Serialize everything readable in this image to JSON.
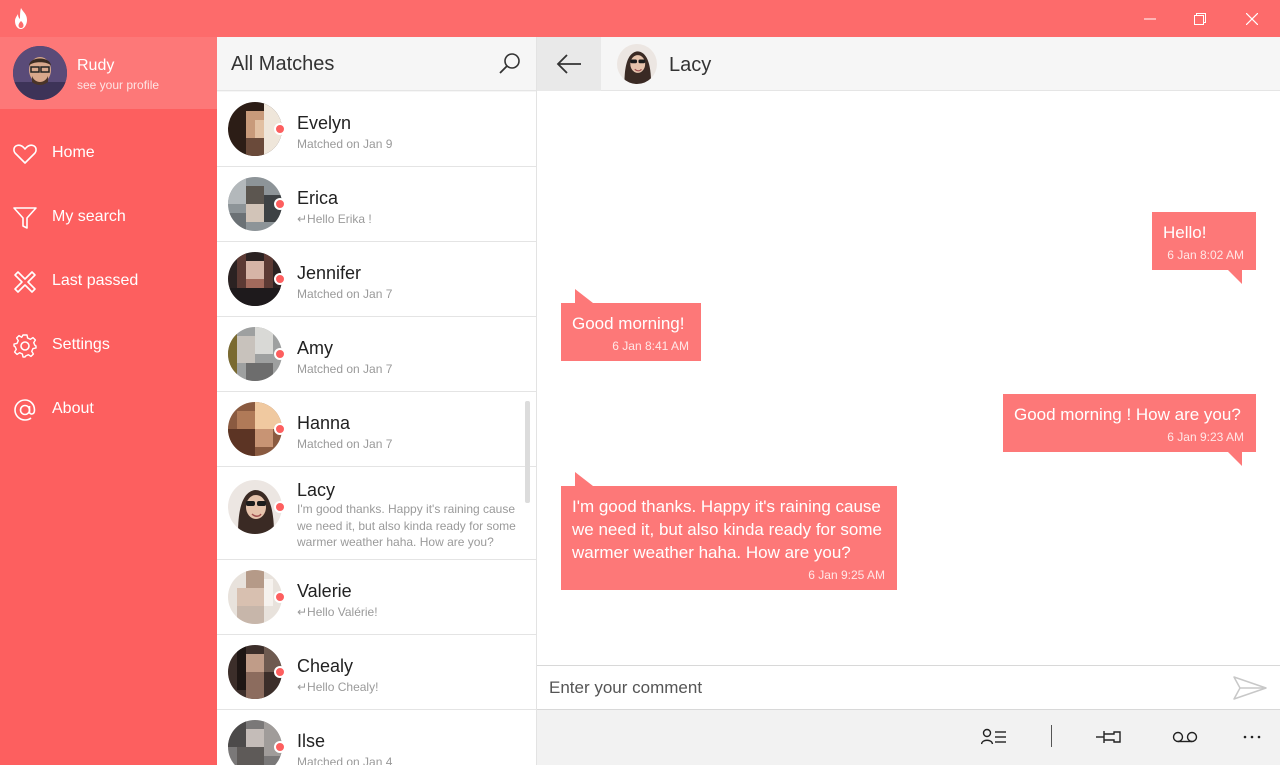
{
  "colors": {
    "accent": "#fd6b6b",
    "sidebar": "#fd5f5f",
    "bubble": "#fd7878",
    "online_dot": "#fd5f5f"
  },
  "titlebar": {
    "logo_icon": "flame-icon",
    "buttons": [
      "minimize-icon",
      "restore-icon",
      "close-icon"
    ]
  },
  "profile": {
    "name": "Rudy",
    "subtitle": "see your profile"
  },
  "nav": [
    {
      "label": "Home",
      "icon": "heart-icon"
    },
    {
      "label": "My search",
      "icon": "filter-icon"
    },
    {
      "label": "Last passed",
      "icon": "cross-icon"
    },
    {
      "label": "Settings",
      "icon": "gear-icon"
    },
    {
      "label": "About",
      "icon": "at-icon"
    }
  ],
  "matches": {
    "title": "All Matches",
    "items": [
      {
        "name": "Evelyn",
        "sub": "Matched on Jan 9"
      },
      {
        "name": "Erica",
        "sub": "↵Hello Erika !"
      },
      {
        "name": "Jennifer",
        "sub": "Matched on Jan 7"
      },
      {
        "name": "Amy",
        "sub": "Matched on Jan 7"
      },
      {
        "name": "Hanna",
        "sub": "Matched on Jan 7"
      },
      {
        "name": "Lacy",
        "sub": "I'm good thanks. Happy it's raining cause we need it, but also kinda ready for some warmer weather haha. How are you?"
      },
      {
        "name": "Valerie",
        "sub": "↵Hello Valérie!"
      },
      {
        "name": "Chealy",
        "sub": "↵Hello Chealy!"
      },
      {
        "name": "Ilse",
        "sub": "Matched on Jan 4"
      }
    ]
  },
  "chat": {
    "contact": "Lacy",
    "messages": [
      {
        "direction": "out",
        "text": "Hello!",
        "time": "6 Jan 8:02 AM"
      },
      {
        "direction": "in",
        "text": "Good morning!",
        "time": "6 Jan 8:41 AM"
      },
      {
        "direction": "out",
        "text": "Good morning ! How are you?",
        "time": "6 Jan 9:23 AM"
      },
      {
        "direction": "in",
        "text": "I'm good thanks. Happy it's raining cause we need it, but also kinda ready for some warmer weather haha. How are you?",
        "time": "6 Jan 9:25 AM"
      }
    ],
    "composer_placeholder": "Enter your comment",
    "actions": [
      "contact-list-icon",
      "pin-icon",
      "voicemail-icon",
      "more-icon"
    ]
  }
}
